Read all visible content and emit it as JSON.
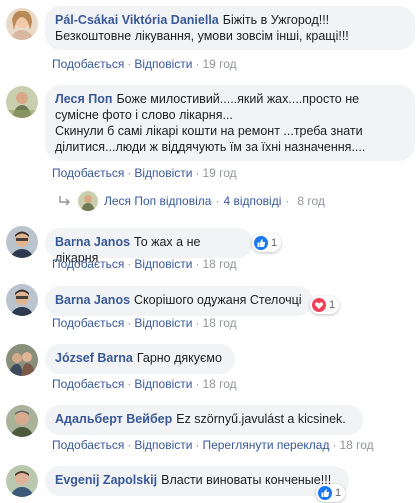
{
  "comments": [
    {
      "name": "Pál-Csákai Viktória Daniella",
      "text": "Біжіть в Ужгород!!! Безкоштовне лікування, умови зовсім інші, кращі!!!",
      "like": "Подобається",
      "reply": "Відповісти",
      "time": "19 год"
    },
    {
      "name": "Леся Поп",
      "text_line1": "Боже милостивий.....який жах....просто не сумісне фото і слово лікарня...",
      "text_line2": "Скинули б самі лікарі кошти на ремонт ...треба знати ділитися...люди ж віддячують їм за їхні назначення....",
      "like": "Подобається",
      "reply": "Відповісти",
      "time": "19 год",
      "replies_author": "Леся Поп відповіла",
      "replies_count": "4 відповіді",
      "replies_time": "8 год"
    },
    {
      "name": "Barna Janos",
      "text": "То жах а не лікарня",
      "like": "Подобається",
      "reply": "Відповісти",
      "time": "18 год",
      "reaction": "like",
      "reaction_count": "1"
    },
    {
      "name": "Barna Janos",
      "text": "Скорішого одужаня Стелочці",
      "like": "Подобається",
      "reply": "Відповісти",
      "time": "18 год",
      "reaction": "love",
      "reaction_count": "1"
    },
    {
      "name": "József Barna",
      "text": "Гарно дякуємо",
      "like": "Подобається",
      "reply": "Відповісти",
      "time": "18 год"
    },
    {
      "name": "Адальберт Вейбер",
      "text": "Ez szörnyű.javulást a kicsinek.",
      "like": "Подобається",
      "reply": "Відповісти",
      "see_translation": "Переглянути переклад",
      "time": "18 год"
    },
    {
      "name": "Evgenij Zapolskij",
      "text": "Власти виноваты конченые!!!",
      "reaction": "like",
      "reaction_count": "1"
    }
  ],
  "colors": {
    "link": "#385898",
    "meta": "#90949c",
    "bubble": "#f2f3f5",
    "like_blue": "#1877f2",
    "love_red": "#f33e58"
  }
}
